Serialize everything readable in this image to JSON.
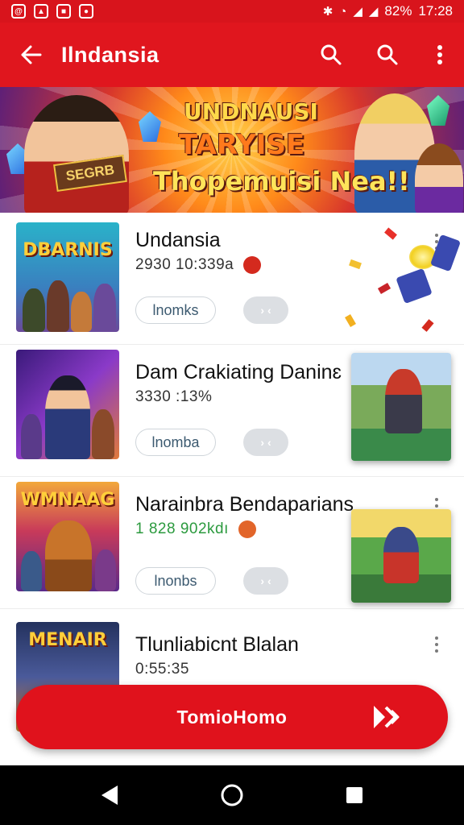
{
  "status_bar": {
    "left_icons": [
      "notification-icon",
      "app-icon",
      "app-icon",
      "app-icon"
    ],
    "battery": "82%",
    "time": "17:28"
  },
  "app_bar": {
    "title": "Ilndansia",
    "back_icon": "arrow-left-icon",
    "actions": [
      "search-icon",
      "search-icon",
      "more-vert-icon"
    ]
  },
  "banner": {
    "title_line_1": "UNDNAUSI",
    "title_line_2": "TARYISE",
    "title_line_3": "Thopemuisi Nea!!",
    "plaque": "SEGRB"
  },
  "list": [
    {
      "thumb_label": "DBARNIS",
      "title": "Undansia",
      "meta": "2930 10:339a",
      "meta_style": "dark",
      "pill": "lnomks",
      "chip": "› ‹",
      "colors": {
        "bg": "#2ab2c9",
        "accent": "#f2c13a"
      }
    },
    {
      "thumb_label": "",
      "title": "Dam Crakiating Daninɛ",
      "meta": "3330 :13%",
      "meta_style": "dark",
      "pill": "lnomba",
      "chip": "› ‹",
      "colors": {
        "bg": "#6a2ca8",
        "accent": "#e78a2a"
      }
    },
    {
      "thumb_label": "WMNAAG",
      "title": "Narainbra Bendaparians",
      "meta": "1 828  902kdı",
      "meta_style": "green",
      "pill": "lnonbs",
      "chip": "› ‹",
      "colors": {
        "bg": "#7d2e9a",
        "accent": "#f4a824"
      }
    },
    {
      "thumb_label": "MENAIR",
      "title": "Tlunliabicnt Blalan",
      "meta": "0:55:35",
      "meta_style": "dark",
      "colors": {
        "bg": "#24325e",
        "accent": "#e0b23a"
      }
    }
  ],
  "action_bar": {
    "label": "TomioHomo",
    "icon": "fast-forward-icon"
  },
  "nav_bar": [
    "back-icon",
    "home-icon",
    "recents-icon"
  ],
  "colors": {
    "primary": "#e0161e",
    "status_bar": "#d8141c",
    "chip": "#dcdfe3",
    "pill_border": "#cfd5da",
    "meta_green": "#2b9a3e"
  }
}
